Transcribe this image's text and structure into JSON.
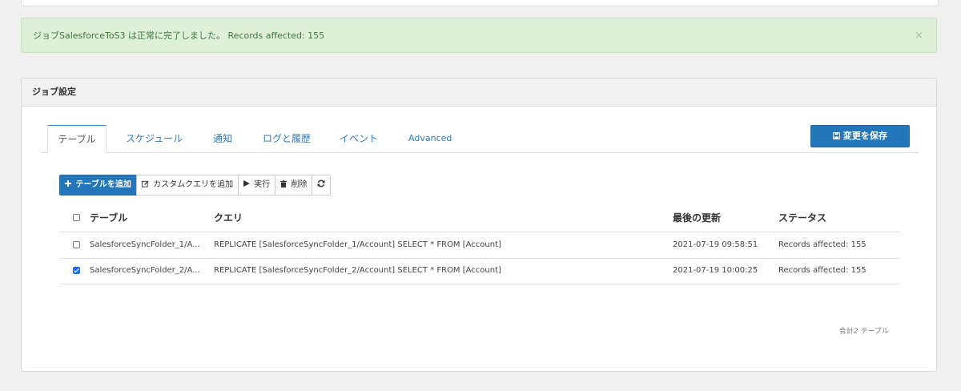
{
  "alert": {
    "message": "ジョブSalesforceToS3 は正常に完了しました。 Records affected: 155",
    "close_glyph": "×"
  },
  "panel": {
    "title": "ジョブ設定"
  },
  "tabs": [
    {
      "label": "テーブル",
      "active": true
    },
    {
      "label": "スケジュール",
      "active": false
    },
    {
      "label": "通知",
      "active": false
    },
    {
      "label": "ログと履歴",
      "active": false
    },
    {
      "label": "イベント",
      "active": false
    },
    {
      "label": "Advanced",
      "active": false
    }
  ],
  "save_button": {
    "label": "変更を保存",
    "icon": "floppy-disk-icon"
  },
  "toolbar": {
    "add_table": {
      "label": "テーブルを追加",
      "icon": "plus-icon"
    },
    "add_custom_query": {
      "label": "カスタムクエリを追加",
      "icon": "edit-icon"
    },
    "run": {
      "label": "実行",
      "icon": "play-icon"
    },
    "delete": {
      "label": "削除",
      "icon": "trash-icon"
    },
    "refresh": {
      "icon": "refresh-icon"
    }
  },
  "table": {
    "columns": [
      "テーブル",
      "クエリ",
      "最後の更新",
      "ステータス"
    ],
    "rows": [
      {
        "checked": false,
        "table": "SalesforceSyncFolder_1/A...",
        "query": "REPLICATE [SalesforceSyncFolder_1/Account] SELECT * FROM [Account]",
        "updated": "2021-07-19 09:58:51",
        "status": "Records affected: 155"
      },
      {
        "checked": true,
        "table": "SalesforceSyncFolder_2/A...",
        "query": "REPLICATE [SalesforceSyncFolder_2/Account] SELECT * FROM [Account]",
        "updated": "2021-07-19 10:00:25",
        "status": "Records affected: 155"
      }
    ]
  },
  "footer": {
    "prefix": "合計",
    "count": "2",
    "suffix": "テーブル"
  },
  "colors": {
    "accent": "#2276b9",
    "success_bg": "#dff0d8",
    "success_text": "#3c763d"
  }
}
